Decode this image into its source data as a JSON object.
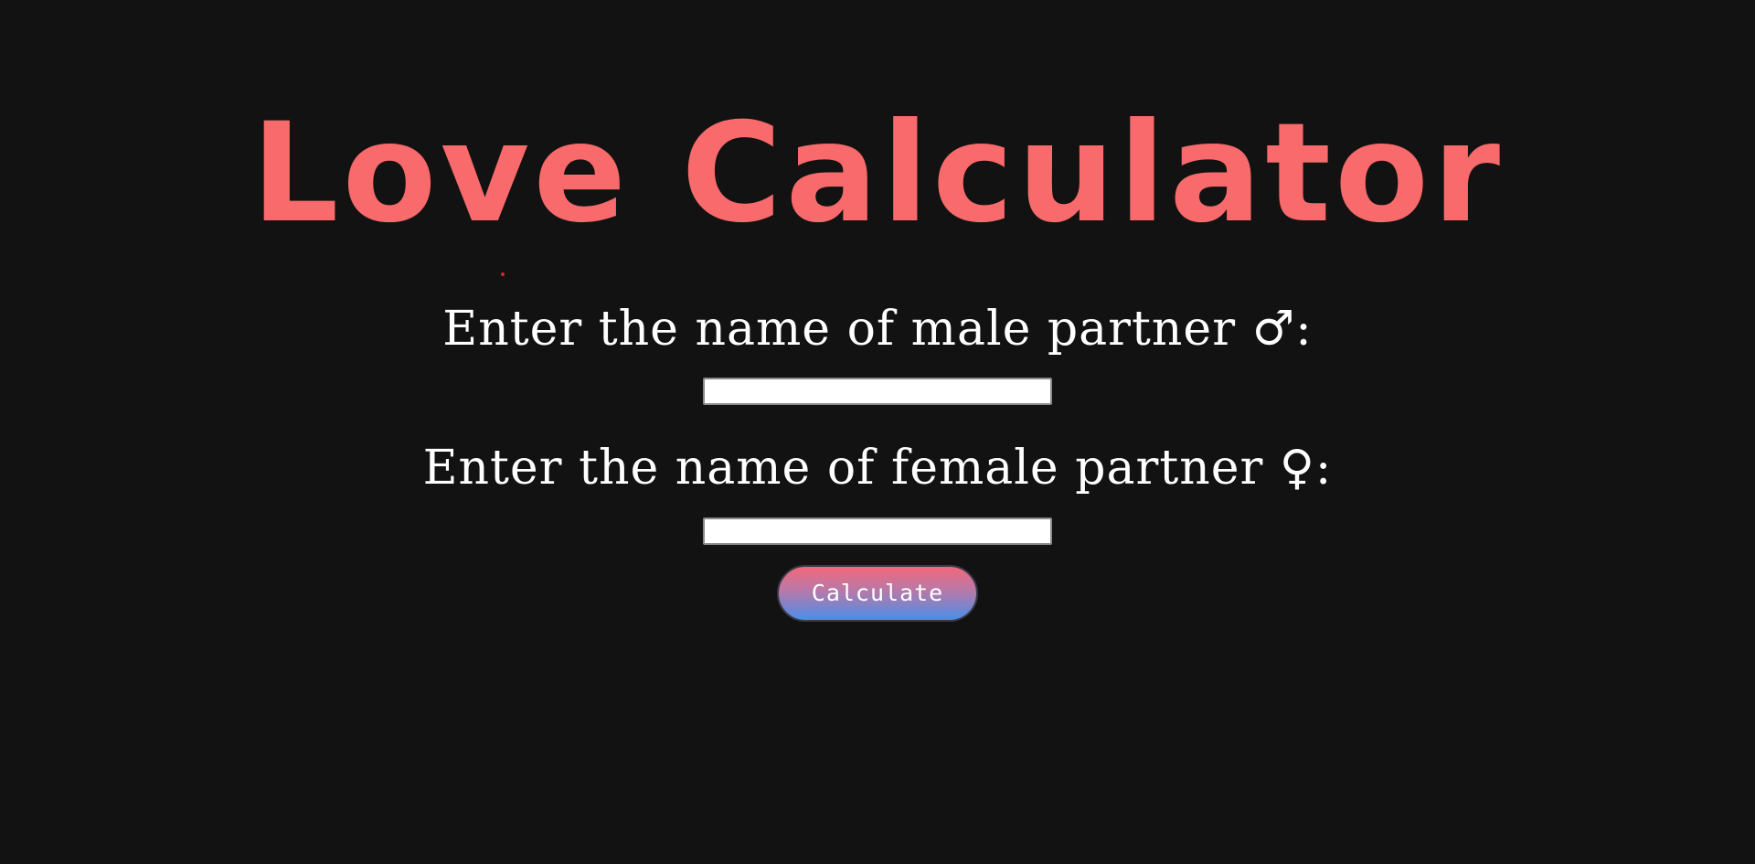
{
  "page": {
    "title": "Love Calculator",
    "background_color": "#121212",
    "accent_color": "#f86a6b"
  },
  "form": {
    "male_label": "Enter the name of male partner ♂:",
    "male_value": "",
    "female_label": "Enter the name of female partner ♀:",
    "female_value": "",
    "calculate_label": "Calculate"
  }
}
